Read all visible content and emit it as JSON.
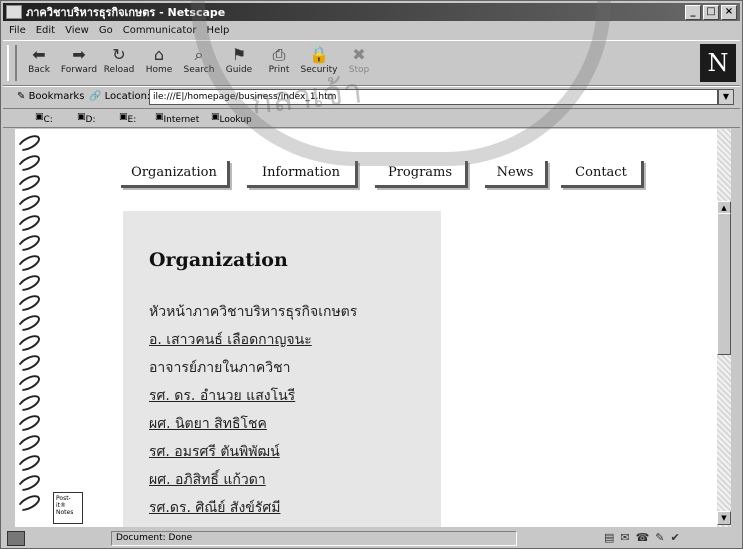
{
  "window": {
    "title": "ภาควิชาบริหารธุรกิจเกษตร - Netscape"
  },
  "menu": [
    "File",
    "Edit",
    "View",
    "Go",
    "Communicator",
    "Help"
  ],
  "nav_buttons": [
    {
      "label": "Back",
      "icon": "back-arrow-icon"
    },
    {
      "label": "Forward",
      "icon": "forward-arrow-icon"
    },
    {
      "label": "Reload",
      "icon": "reload-icon"
    },
    {
      "label": "Home",
      "icon": "home-icon"
    },
    {
      "label": "Search",
      "icon": "search-icon"
    },
    {
      "label": "Guide",
      "icon": "guide-icon"
    },
    {
      "label": "Print",
      "icon": "print-icon"
    },
    {
      "label": "Security",
      "icon": "security-lock-icon"
    },
    {
      "label": "Stop",
      "icon": "stop-icon"
    }
  ],
  "brand": {
    "letter": "N"
  },
  "location": {
    "bookmarks_label": "Bookmarks",
    "location_label": "Location:",
    "url": "ile:///E|/homepage/business/index_1.htm"
  },
  "personal_toolbar": [
    "C:",
    "D:",
    "E:",
    "Internet",
    "Lookup"
  ],
  "site_nav": [
    "Organization",
    "Information",
    "Programs",
    "News",
    "Contact"
  ],
  "page": {
    "heading": "Organization",
    "lines": [
      {
        "text": "หัวหน้าภาควิชาบริหารธุรกิจเกษตร",
        "link": false
      },
      {
        "text": "อ. เสาวคนธ์ เลือดกาญจนะ",
        "link": true
      },
      {
        "text": "อาจารย์ภายในภาควิชา",
        "link": false
      },
      {
        "text": "รศ. ดร. อำนวย แสงโนรี",
        "link": true
      },
      {
        "text": "ผศ. นิตยา สิทธิโชค",
        "link": true
      },
      {
        "text": "รศ. อมรศรี ตันพิพัฒน์",
        "link": true
      },
      {
        "text": "ผศ. อภิสิทธิ์ แก้วดา",
        "link": true
      },
      {
        "text": "รศ.ดร. ศิณีย์ สังข์รัศมี",
        "link": true
      }
    ]
  },
  "status": {
    "message": "Document: Done"
  },
  "postit": {
    "text": "Post-it® Notes"
  },
  "watermark": {
    "text": "กลาเจ้า"
  }
}
